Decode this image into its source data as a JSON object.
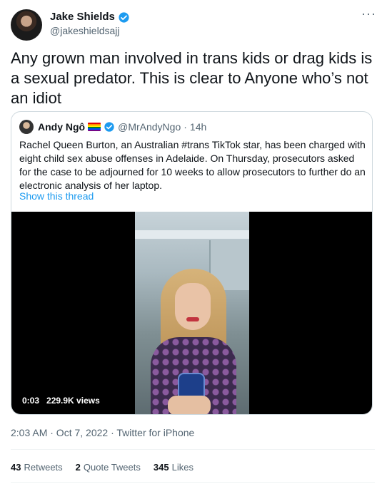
{
  "author": {
    "name": "Jake Shields",
    "handle": "@jakeshieldsajj",
    "verified": true,
    "verified_color": "#1d9bf0"
  },
  "tweet": {
    "text": "Any grown man involved in trans kids or drag kids is a sexual predator.  This is clear to Anyone who’s not an idiot"
  },
  "quoted": {
    "name": "Andy Ngô",
    "handle": "@MrAndyNgo",
    "separator": "·",
    "time": "14h",
    "text": "Rachel Queen Burton, an Australian #trans TikTok star, has been charged with eight child sex abuse offenses in Adelaide. On Thursday, prosecutors asked for the case to be adjourned for 10 weeks to allow prosecutors to further do an electronic analysis of her laptop.",
    "show_thread": "Show this thread",
    "video": {
      "duration": "0:03",
      "views": "229.9K views"
    }
  },
  "timestamp": "2:03 AM · Oct 7, 2022 · Twitter for iPhone",
  "engagement": {
    "retweets_count": "43",
    "retweets_label": "Retweets",
    "quotes_count": "2",
    "quotes_label": "Quote Tweets",
    "likes_count": "345",
    "likes_label": "Likes"
  },
  "more_glyph": "···",
  "colors": {
    "accent": "#1d9bf0",
    "muted": "#536471",
    "text": "#0f1419",
    "border": "#cfd9de"
  }
}
